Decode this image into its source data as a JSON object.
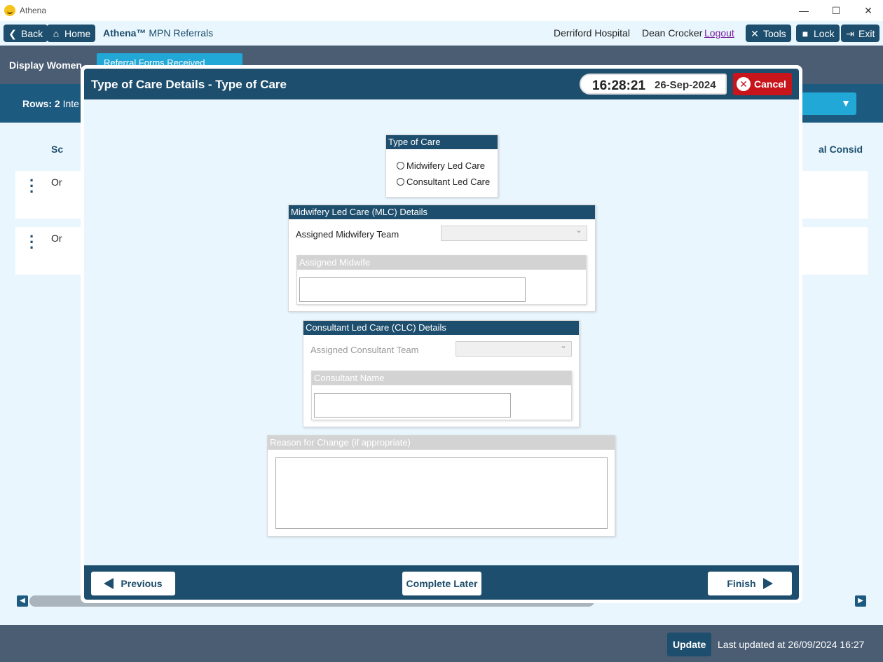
{
  "window": {
    "title": "Athena",
    "minimize": "—",
    "maximize": "☐",
    "close": "✕"
  },
  "toolbar": {
    "back_label": "Back",
    "home_label": "Home",
    "app_brand": "Athena™",
    "app_module": "MPN Referrals",
    "hospital": "Derriford Hospital",
    "user": "Dean Crocker",
    "logout_label": "Logout",
    "tools_label": "Tools",
    "lock_label": "Lock",
    "exit_label": "Exit"
  },
  "background": {
    "display_label": "Display Women...",
    "dropdown_value": "Referral Forms Received",
    "rows_label": "Rows: 2",
    "rows_suffix": "Inte",
    "col_left": "Sc",
    "col_right": "al Consid",
    "row1_text": "Or",
    "row2_text": "Or",
    "update_label": "Update",
    "last_updated": "Last updated at 26/09/2024 16:27"
  },
  "modal": {
    "title": "Type of Care Details - Type of Care",
    "time": "16:28:21",
    "date": "26-Sep-2024",
    "cancel_label": "Cancel",
    "type_of_care": {
      "heading": "Type of Care",
      "options": [
        "Midwifery Led Care",
        "Consultant Led Care"
      ]
    },
    "mlc": {
      "heading": "Midwifery Led Care (MLC) Details",
      "team_label": "Assigned Midwifery Team",
      "team_value": "",
      "midwife_heading": "Assigned Midwife",
      "midwife_value": ""
    },
    "clc": {
      "heading": "Consultant Led Care (CLC) Details",
      "team_label": "Assigned Consultant Team",
      "team_value": "",
      "consultant_heading": "Consultant Name",
      "consultant_value": ""
    },
    "reason": {
      "heading": "Reason for Change (if appropriate)",
      "value": ""
    },
    "footer": {
      "previous_label": "Previous",
      "complete_later_label": "Complete Later",
      "finish_label": "Finish"
    }
  }
}
